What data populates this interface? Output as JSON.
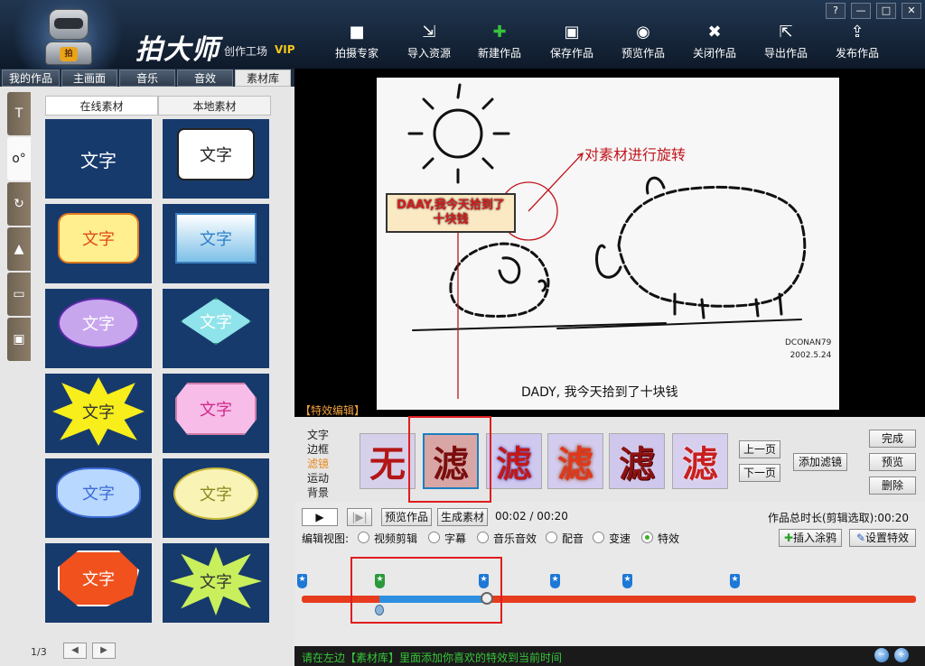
{
  "app": {
    "brand": "拍大师",
    "subtitle": "创作工场",
    "vip": "VIP",
    "badge": "拍"
  },
  "window_controls": [
    "?",
    "—",
    "□",
    "✕"
  ],
  "toolbar": [
    {
      "label": "拍摄专家",
      "icon": "camera-icon"
    },
    {
      "label": "导入资源",
      "icon": "import-icon"
    },
    {
      "label": "新建作品",
      "icon": "new-icon"
    },
    {
      "label": "保存作品",
      "icon": "save-icon"
    },
    {
      "label": "预览作品",
      "icon": "eye-icon"
    },
    {
      "label": "关闭作品",
      "icon": "close-doc-icon"
    },
    {
      "label": "导出作品",
      "icon": "export-icon"
    },
    {
      "label": "发布作品",
      "icon": "upload-icon"
    }
  ],
  "main_tabs": [
    "我的作品",
    "主画面",
    "音乐",
    "音效",
    "素材库"
  ],
  "active_tab": "素材库",
  "side_tabs": [
    "T",
    "o°",
    "↻",
    "▲",
    "▭",
    "▣"
  ],
  "library": {
    "sub_tabs": [
      "在线素材",
      "本地素材"
    ],
    "cell_label": "文字",
    "page": "1/3",
    "prev": "◀",
    "next": "▶"
  },
  "preview": {
    "caption": "DADY, 我今天拾到了十块钱",
    "signature": [
      "DCONAN79",
      "2002.5.24"
    ],
    "annotation": "对素材进行旋转",
    "text_object": [
      "DAAY,我今天拾到了",
      "十块钱"
    ]
  },
  "fx": {
    "section_label": "【特效编辑】",
    "categories": [
      "文字",
      "边框",
      "滤镜",
      "运动",
      "背景"
    ],
    "active_category": "滤镜",
    "thumbs": [
      "无",
      "滤",
      "滤",
      "滤",
      "滤",
      "滤"
    ],
    "prev_page": "上一页",
    "next_page": "下一页",
    "add_filter": "添加滤镜",
    "done": "完成",
    "preview": "预览",
    "delete": "删除"
  },
  "controls": {
    "play": "▶",
    "step": "|▶|",
    "preview_btn": "预览作品",
    "generate_btn": "生成素材",
    "time": "00:02 / 00:20",
    "total": "作品总时长(剪辑选取):00:20",
    "view_label": "编辑视图:",
    "views": [
      "视频剪辑",
      "字幕",
      "音乐音效",
      "配音",
      "变速",
      "特效"
    ],
    "active_view": "特效",
    "insert_doodle": "插入涂鸦",
    "set_effect": "设置特效"
  },
  "status": {
    "text": "请在左边【素材库】里面添加你喜欢的特效到当前时间"
  },
  "colors": {
    "accent_red": "#e01d1d",
    "track": "#e73b1e",
    "selection": "#2e8fe0",
    "status_text": "#37c53a"
  }
}
